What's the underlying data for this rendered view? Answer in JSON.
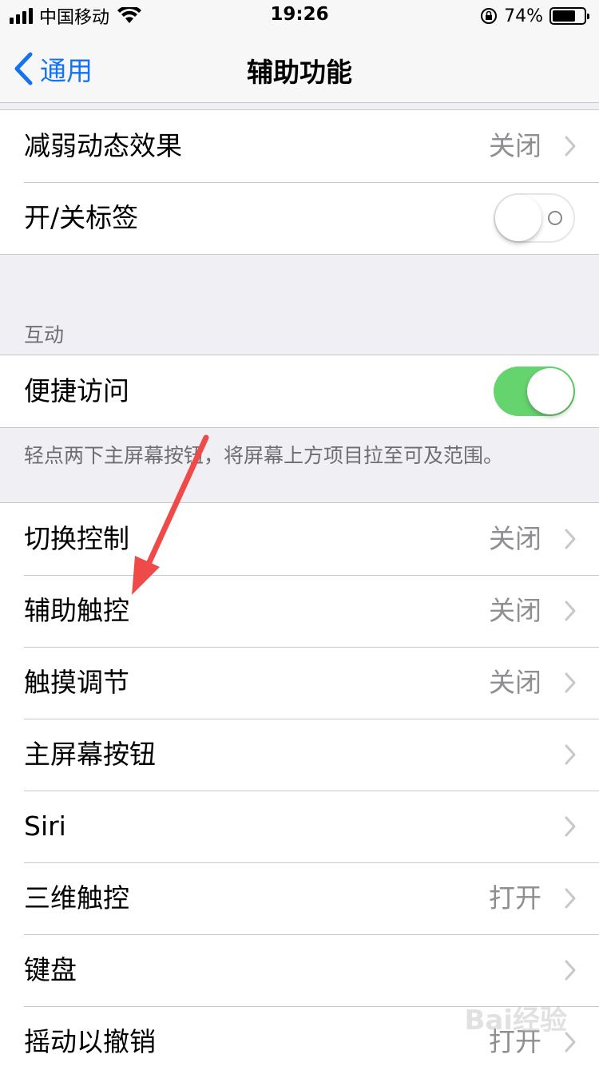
{
  "status_bar": {
    "carrier": "中国移动",
    "time": "19:26",
    "battery_percent": "74%",
    "battery_level": 0.74,
    "icons": [
      "signal-icon",
      "wifi-icon",
      "rotation-lock-icon",
      "battery-icon"
    ]
  },
  "nav": {
    "back_label": "通用",
    "title": "辅助功能"
  },
  "colors": {
    "accent": "#1474f0",
    "switch_on": "#65d36e",
    "secondary_text": "#8e8e93"
  },
  "groups": {
    "motion": {
      "reduce_motion": {
        "label": "减弱动态效果",
        "value": "关闭"
      },
      "on_off_labels": {
        "label": "开/关标签",
        "switch": false
      }
    },
    "interaction": {
      "header": "互动",
      "reachability": {
        "label": "便捷访问",
        "switch": true
      },
      "footer": "轻点两下主屏幕按钮，将屏幕上方项目拉至可及范围。"
    },
    "controls": {
      "items": [
        {
          "label": "切换控制",
          "value": "关闭"
        },
        {
          "label": "辅助触控",
          "value": "关闭"
        },
        {
          "label": "触摸调节",
          "value": "关闭"
        },
        {
          "label": "主屏幕按钮",
          "value": ""
        },
        {
          "label": "Siri",
          "value": ""
        },
        {
          "label": "三维触控",
          "value": "打开"
        },
        {
          "label": "键盘",
          "value": ""
        },
        {
          "label": "摇动以撤销",
          "value": "打开"
        }
      ]
    }
  },
  "watermark": "Bai经验"
}
